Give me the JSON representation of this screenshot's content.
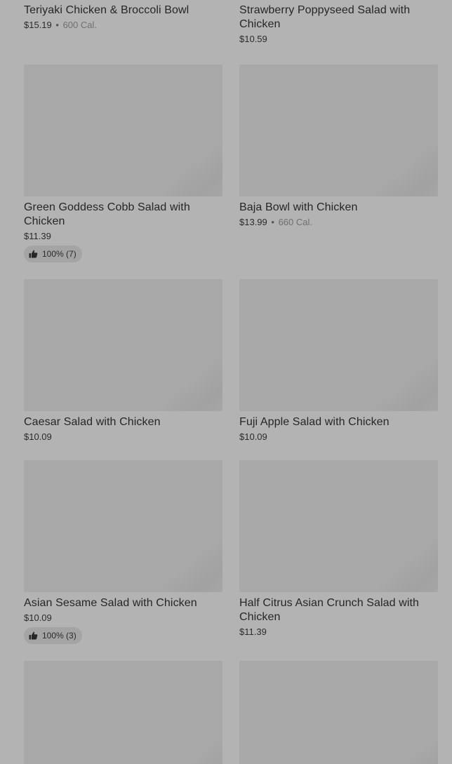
{
  "items": [
    {
      "name": "Teriyaki Chicken & Broccoli Bowl",
      "price": "$15.19",
      "sep": "•",
      "calories": "600 Cal."
    },
    {
      "name": "Strawberry Poppyseed Salad with Chicken",
      "price": "$10.59"
    },
    {
      "name": "Green Goddess Cobb Salad with Chicken",
      "price": "$11.39",
      "rating": "100% (7)",
      "rating_icon": "thumbs-up-icon"
    },
    {
      "name": "Baja Bowl with Chicken",
      "price": "$13.99",
      "sep": "•",
      "calories": "660 Cal."
    },
    {
      "name": "Caesar Salad with Chicken",
      "price": "$10.09"
    },
    {
      "name": "Fuji Apple Salad with Chicken",
      "price": "$10.09"
    },
    {
      "name": "Asian Sesame Salad with Chicken",
      "price": "$10.09",
      "rating": "100% (3)",
      "rating_icon": "thumbs-up-icon"
    },
    {
      "name": "Half Citrus Asian Crunch Salad with Chicken",
      "price": "$11.39"
    }
  ],
  "colors": {
    "background": "#b3b3b3",
    "image_placeholder": "#a8a8a8",
    "text": "#262626",
    "calories_text": "#6f6f6f",
    "badge_background": "#a4a4a4"
  }
}
